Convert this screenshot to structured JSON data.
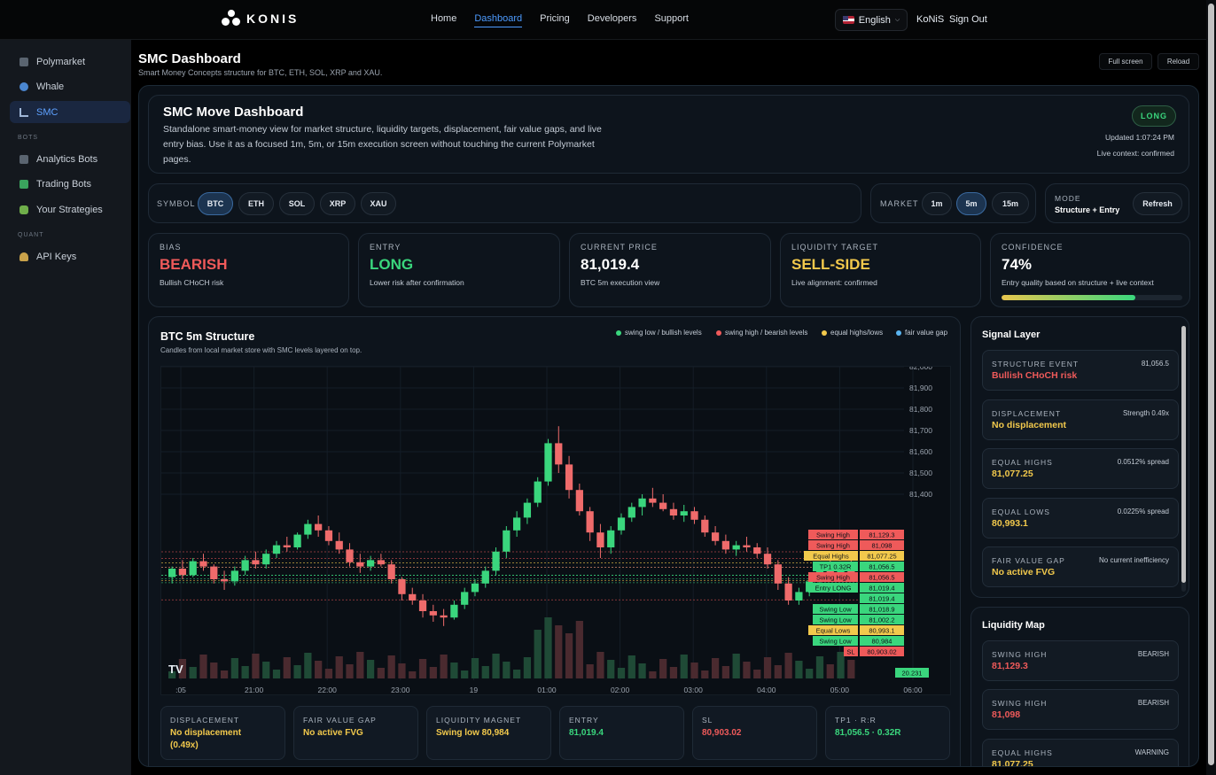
{
  "brand": {
    "name": "KONIS"
  },
  "nav": {
    "items": [
      "Home",
      "Dashboard",
      "Pricing",
      "Developers",
      "Support"
    ],
    "active": "Dashboard"
  },
  "language": "English",
  "user": {
    "name": "KoNiS",
    "signout": "Sign Out"
  },
  "sidebar": {
    "items": [
      {
        "label": "Polymarket",
        "icon": "bar-chart-icon"
      },
      {
        "label": "Whale",
        "icon": "whale-icon"
      },
      {
        "label": "SMC",
        "icon": "structure-icon",
        "active": true
      }
    ],
    "bots_header": "BOTS",
    "bots": [
      {
        "label": "Analytics Bots",
        "icon": "analytics-icon"
      },
      {
        "label": "Trading Bots",
        "icon": "trading-icon"
      },
      {
        "label": "Your Strategies",
        "icon": "puzzle-icon"
      }
    ],
    "quant_header": "QUANT",
    "quant": [
      {
        "label": "API Keys",
        "icon": "key-icon"
      }
    ]
  },
  "page": {
    "title": "SMC Dashboard",
    "subtitle": "Smart Money Concepts structure for BTC, ETH, SOL, XRP and XAU.",
    "fullscreen": "Full screen",
    "reload": "Reload"
  },
  "hero": {
    "title": "SMC Move Dashboard",
    "description": "Standalone smart-money view for market structure, liquidity targets, displacement, fair value gaps, and live entry bias. Use it as a focused 1m, 5m, or 15m execution screen without touching the current Polymarket pages.",
    "badge": "LONG",
    "updated": "Updated 1:07:24 PM",
    "live_context": "Live context: confirmed"
  },
  "controls": {
    "symbol_label": "SYMBOL",
    "symbols": [
      "BTC",
      "ETH",
      "SOL",
      "XRP",
      "XAU"
    ],
    "selected_symbol": "BTC",
    "market_label": "MARKET",
    "timeframes": [
      "1m",
      "5m",
      "15m"
    ],
    "selected_timeframe": "5m",
    "mode_label": "MODE",
    "mode_value": "Structure + Entry",
    "refresh": "Refresh"
  },
  "summary": [
    {
      "label": "BIAS",
      "value": "BEARISH",
      "sub": "Bullish CHoCH risk",
      "tone": "red"
    },
    {
      "label": "ENTRY",
      "value": "LONG",
      "sub": "Lower risk after confirmation",
      "tone": "green"
    },
    {
      "label": "CURRENT PRICE",
      "value": "81,019.4",
      "sub": "BTC 5m execution view",
      "tone": "white"
    },
    {
      "label": "LIQUIDITY TARGET",
      "value": "SELL-SIDE",
      "sub": "Live alignment: confirmed",
      "tone": "yellow"
    },
    {
      "label": "CONFIDENCE",
      "value": "74%",
      "sub": "Entry quality based on structure + live context",
      "tone": "white",
      "progress": 0.74
    }
  ],
  "chart": {
    "title": "BTC 5m Structure",
    "subtitle": "Candles from local market store with SMC levels layered on top.",
    "legend": [
      {
        "label": "swing low / bullish levels",
        "color": "#3ad67d"
      },
      {
        "label": "swing high / bearish levels",
        "color": "#ef5a5a"
      },
      {
        "label": "equal highs/lows",
        "color": "#f2c94c"
      },
      {
        "label": "fair value gap",
        "color": "#5ab4f0"
      }
    ],
    "watermark": "TV"
  },
  "chart_data": {
    "type": "candlestick",
    "title": "BTC 5m Structure",
    "y_ticks": [
      "82,000",
      "81,900",
      "81,800",
      "81,700",
      "81,600",
      "81,500",
      "81,400"
    ],
    "x_ticks": [
      ":05",
      "21:00",
      "22:00",
      "23:00",
      "19",
      "01:00",
      "02:00",
      "03:00",
      "04:00",
      "05:00",
      "06:00"
    ],
    "ylim": [
      80700,
      82000
    ],
    "candles": [
      [
        81010,
        81060,
        80980,
        81050
      ],
      [
        81050,
        81090,
        81000,
        81020
      ],
      [
        81020,
        81100,
        81010,
        81085
      ],
      [
        81085,
        81120,
        81040,
        81060
      ],
      [
        81060,
        81070,
        80980,
        81000
      ],
      [
        81000,
        81040,
        80950,
        80990
      ],
      [
        80990,
        81060,
        80970,
        81040
      ],
      [
        81040,
        81110,
        81020,
        81090
      ],
      [
        81090,
        81130,
        81050,
        81070
      ],
      [
        81070,
        81140,
        81050,
        81120
      ],
      [
        81120,
        81180,
        81100,
        81160
      ],
      [
        81160,
        81200,
        81130,
        81150
      ],
      [
        81150,
        81220,
        81140,
        81210
      ],
      [
        81210,
        81280,
        81190,
        81260
      ],
      [
        81260,
        81300,
        81200,
        81230
      ],
      [
        81230,
        81250,
        81160,
        81180
      ],
      [
        81180,
        81220,
        81120,
        81140
      ],
      [
        81140,
        81170,
        81060,
        81080
      ],
      [
        81080,
        81120,
        81030,
        81060
      ],
      [
        81060,
        81110,
        81040,
        81090
      ],
      [
        81090,
        81120,
        81060,
        81070
      ],
      [
        81070,
        81090,
        80980,
        81000
      ],
      [
        81000,
        81010,
        80900,
        80930
      ],
      [
        80930,
        80960,
        80880,
        80900
      ],
      [
        80900,
        80930,
        80820,
        80850
      ],
      [
        80850,
        80880,
        80800,
        80830
      ],
      [
        80830,
        80860,
        80780,
        80820
      ],
      [
        80820,
        80900,
        80810,
        80880
      ],
      [
        80880,
        80960,
        80860,
        80940
      ],
      [
        80940,
        81000,
        80920,
        80980
      ],
      [
        80980,
        81060,
        80960,
        81040
      ],
      [
        81040,
        81150,
        81020,
        81130
      ],
      [
        81130,
        81250,
        81100,
        81230
      ],
      [
        81230,
        81320,
        81200,
        81290
      ],
      [
        81290,
        81380,
        81260,
        81360
      ],
      [
        81360,
        81480,
        81340,
        81460
      ],
      [
        81460,
        81660,
        81440,
        81640
      ],
      [
        81640,
        81720,
        81500,
        81540
      ],
      [
        81540,
        81580,
        81380,
        81420
      ],
      [
        81420,
        81450,
        81300,
        81320
      ],
      [
        81320,
        81340,
        81180,
        81220
      ],
      [
        81220,
        81260,
        81100,
        81150
      ],
      [
        81150,
        81250,
        81120,
        81230
      ],
      [
        81230,
        81310,
        81210,
        81290
      ],
      [
        81290,
        81360,
        81270,
        81340
      ],
      [
        81340,
        81400,
        81300,
        81380
      ],
      [
        81380,
        81430,
        81340,
        81360
      ],
      [
        81360,
        81400,
        81320,
        81330
      ],
      [
        81330,
        81360,
        81280,
        81300
      ],
      [
        81300,
        81350,
        81270,
        81320
      ],
      [
        81320,
        81340,
        81260,
        81280
      ],
      [
        81280,
        81300,
        81200,
        81220
      ],
      [
        81220,
        81250,
        81160,
        81180
      ],
      [
        81180,
        81210,
        81120,
        81140
      ],
      [
        81140,
        81180,
        81110,
        81160
      ],
      [
        81160,
        81200,
        81130,
        81150
      ],
      [
        81150,
        81170,
        81100,
        81120
      ],
      [
        81120,
        81150,
        81050,
        81070
      ],
      [
        81070,
        81090,
        80950,
        80980
      ],
      [
        80980,
        81010,
        80880,
        80900
      ],
      [
        80900,
        80960,
        80880,
        80940
      ],
      [
        80940,
        81010,
        80920,
        80990
      ],
      [
        80990,
        81060,
        80970,
        81040
      ],
      [
        81040,
        81090,
        81000,
        81020
      ],
      [
        81020,
        81080,
        80990,
        81060
      ],
      [
        81060,
        81100,
        81020,
        81030
      ]
    ],
    "levels": [
      {
        "label": "Swing High",
        "price": "81,129.3",
        "value": 81129.3,
        "color": "#ef5a5a"
      },
      {
        "label": "Swing High",
        "price": "81,098",
        "value": 81098,
        "color": "#ef5a5a"
      },
      {
        "label": "Equal Highs",
        "price": "81,077.25",
        "value": 81077.25,
        "color": "#f2c94c"
      },
      {
        "label": "TP1 0.32R",
        "price": "81,056.5",
        "value": 81056.5,
        "color": "#3ad67d"
      },
      {
        "label": "Swing High",
        "price": "81,056.5",
        "value": 81056.5,
        "color": "#ef5a5a"
      },
      {
        "label": "Entry LONG",
        "price": "81,019.4",
        "value": 81019.4,
        "color": "#3ad67d"
      },
      {
        "label": "",
        "price": "81,019.4",
        "value": 81019.4,
        "color": "#3ad67d"
      },
      {
        "label": "Swing Low",
        "price": "81,018.9",
        "value": 81018.9,
        "color": "#3ad67d"
      },
      {
        "label": "Swing Low",
        "price": "81,002.2",
        "value": 81002.2,
        "color": "#3ad67d"
      },
      {
        "label": "Equal Lows",
        "price": "80,993.1",
        "value": 80993.1,
        "color": "#f2c94c"
      },
      {
        "label": "Swing Low",
        "price": "80,984",
        "value": 80984,
        "color": "#3ad67d"
      },
      {
        "label": "SL",
        "price": "80,903.02",
        "value": 80903.02,
        "color": "#ef5a5a"
      }
    ],
    "volume_label": "20.231"
  },
  "stats": [
    {
      "label": "DISPLACEMENT",
      "value": "No displacement (0.49x)",
      "tone": "yellow"
    },
    {
      "label": "FAIR VALUE GAP",
      "value": "No active FVG",
      "tone": "yellow"
    },
    {
      "label": "LIQUIDITY MAGNET",
      "value": "Swing low 80,984",
      "tone": "yellow"
    },
    {
      "label": "ENTRY",
      "value": "81,019.4",
      "tone": "green"
    },
    {
      "label": "SL",
      "value": "80,903.02",
      "tone": "red"
    },
    {
      "label": "TP1 · R:R",
      "value": "81,056.5 · 0.32R",
      "tone": "green"
    }
  ],
  "signal_layer": {
    "title": "Signal Layer",
    "items": [
      {
        "label": "STRUCTURE EVENT",
        "right": "81,056.5",
        "value": "Bullish CHoCH risk",
        "tone": "red"
      },
      {
        "label": "DISPLACEMENT",
        "right": "Strength 0.49x",
        "value": "No displacement",
        "tone": "yellow"
      },
      {
        "label": "EQUAL HIGHS",
        "right": "0.0512% spread",
        "value": "81,077.25",
        "tone": "yellow"
      },
      {
        "label": "EQUAL LOWS",
        "right": "0.0225% spread",
        "value": "80,993.1",
        "tone": "yellow"
      },
      {
        "label": "FAIR VALUE GAP",
        "right": "No current inefficiency",
        "value": "No active FVG",
        "tone": "yellow"
      }
    ]
  },
  "liquidity_map": {
    "title": "Liquidity Map",
    "items": [
      {
        "label": "SWING HIGH",
        "right": "BEARISH",
        "value": "81,129.3",
        "tone": "red"
      },
      {
        "label": "SWING HIGH",
        "right": "BEARISH",
        "value": "81,098",
        "tone": "red"
      },
      {
        "label": "EQUAL HIGHS",
        "right": "WARNING",
        "value": "81,077.25",
        "tone": "yellow"
      }
    ]
  }
}
